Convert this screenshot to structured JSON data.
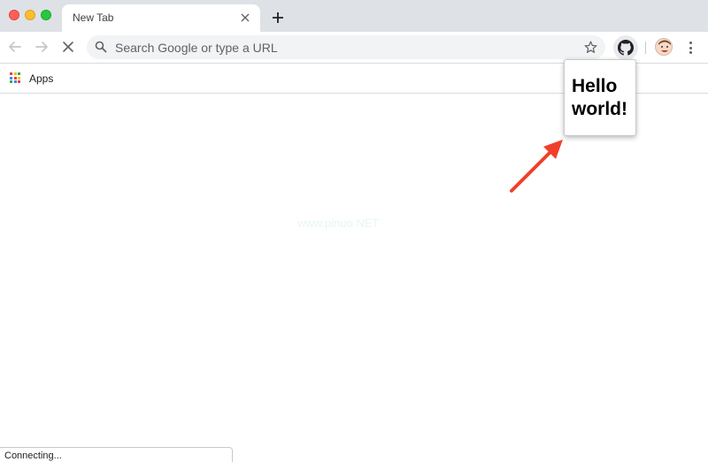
{
  "window": {
    "traffic_lights": {
      "close": "#fe5f57",
      "minimize": "#febc2e",
      "zoom": "#28c840"
    }
  },
  "tab": {
    "title": "New Tab",
    "close_icon": "close-icon",
    "new_tab_icon": "plus-icon"
  },
  "toolbar": {
    "back_icon": "arrow-left-icon",
    "forward_icon": "arrow-right-icon",
    "stop_icon": "close-icon",
    "omnibox_placeholder": "Search Google or type a URL",
    "bookmark_icon": "star-icon",
    "extension_icon": "github-icon",
    "profile_icon": "avatar",
    "menu_icon": "more-vert-icon"
  },
  "bookmarks": {
    "apps_label": "Apps"
  },
  "popup": {
    "text": "Hello world!"
  },
  "watermark": {
    "text": "www.pinuo.NET"
  },
  "status": {
    "text": "Connecting..."
  },
  "colors": {
    "tabstrip": "#dee1e6",
    "omnibox": "#f1f3f4",
    "annotation_arrow": "#f0402b"
  }
}
